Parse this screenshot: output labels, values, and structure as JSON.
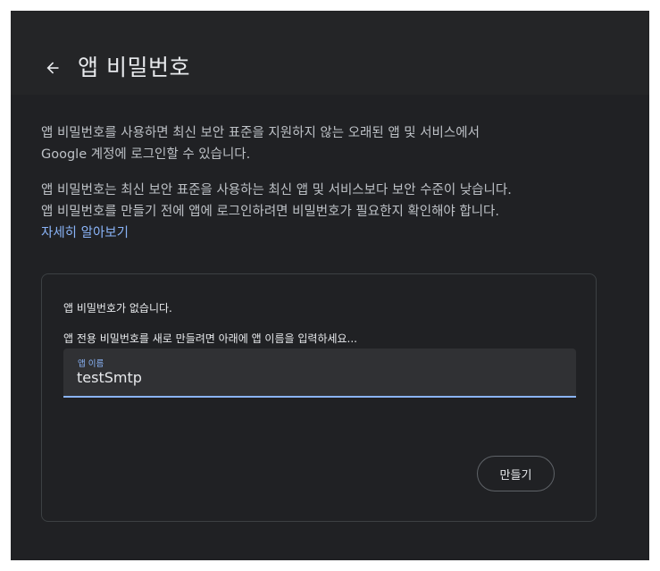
{
  "header": {
    "back_icon": "arrow-left-icon",
    "title": "앱 비밀번호"
  },
  "intro": {
    "line1": "앱 비밀번호를 사용하면 최신 보안 표준을 지원하지 않는 오래된 앱 및 서비스에서",
    "line2": "Google 계정에 로그인할 수 있습니다."
  },
  "warning": {
    "line1": "앱 비밀번호는 최신 보안 표준을 사용하는 최신 앱 및 서비스보다 보안 수준이 낮습니다.",
    "line2": "앱 비밀번호를 만들기 전에 앱에 로그인하려면 비밀번호가 필요한지 확인해야 합니다.",
    "learn_more": "자세히 알아보기"
  },
  "card": {
    "empty_message": "앱 비밀번호가 없습니다.",
    "instruction": "앱 전용 비밀번호를 새로 만들려면 아래에 앱 이름을 입력하세요...",
    "field_label": "앱 이름",
    "field_value": "testSmtp",
    "create_label": "만들기"
  },
  "colors": {
    "background": "#202124",
    "header_background": "#242527",
    "accent": "#8ab4f8",
    "text_primary": "#e8eaed",
    "text_secondary": "#bdc1c6"
  }
}
